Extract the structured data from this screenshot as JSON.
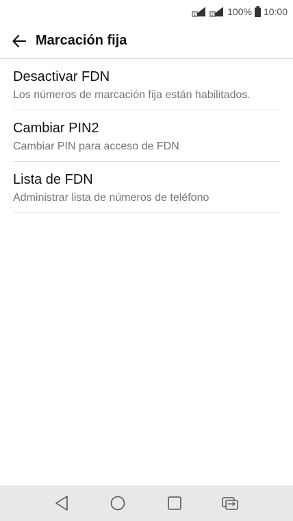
{
  "status_bar": {
    "battery_percent": "100%",
    "time": "10:00",
    "icons": [
      "sim1-signal-icon",
      "sim2-signal-icon",
      "battery-icon"
    ]
  },
  "app_bar": {
    "title": "Marcación fija",
    "back_icon": "back-arrow-icon"
  },
  "settings": {
    "items": [
      {
        "title": "Desactivar FDN",
        "subtitle": "Los números de marcación fija están habilitados."
      },
      {
        "title": "Cambiar PIN2",
        "subtitle": "Cambiar PIN para acceso de FDN"
      },
      {
        "title": "Lista de FDN",
        "subtitle": "Administrar lista de números de teléfono"
      }
    ]
  },
  "nav_bar": {
    "buttons": [
      "back-triangle-icon",
      "home-circle-icon",
      "recents-square-icon",
      "dual-window-icon"
    ]
  },
  "colors": {
    "background": "#ffffff",
    "nav_bar": "#e8e8e8",
    "subtitle": "#757575",
    "divider": "#e1e1e1"
  }
}
